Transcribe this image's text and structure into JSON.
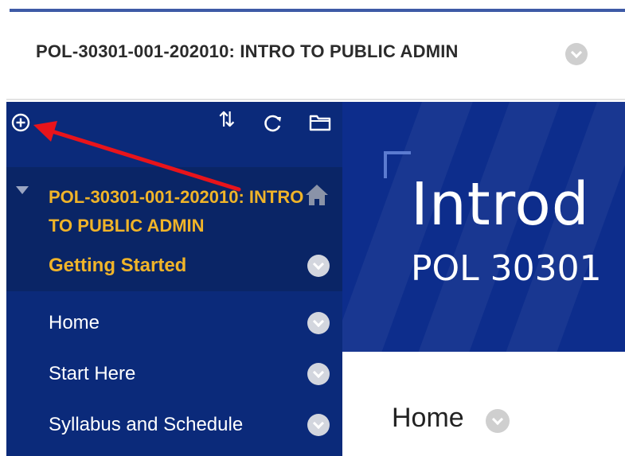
{
  "course_header": {
    "title": "POL-30301-001-202010: INTRO TO PUBLIC ADMIN",
    "menu_icon": "chevron-down-icon"
  },
  "sidebar": {
    "toolbar": {
      "add_icon": "plus-circle-icon",
      "sort_icon": "reorder-arrows-icon",
      "refresh_icon": "refresh-icon",
      "folder_icon": "folder-icon"
    },
    "course_name": "POL-30301-001-202010: INTRO TO PUBLIC ADMIN",
    "home_icon": "home-icon",
    "items": [
      {
        "label": "Getting Started",
        "active": true
      },
      {
        "label": "Home",
        "active": false
      },
      {
        "label": "Start Here",
        "active": false
      },
      {
        "label": "Syllabus and Schedule",
        "active": false
      }
    ]
  },
  "banner": {
    "title": "Introd",
    "subtitle": "POL 30301"
  },
  "content": {
    "heading": "Home"
  },
  "colors": {
    "sidebar_bg": "#0b2a7a",
    "sidebar_active_bg": "#0a2566",
    "accent_gold": "#f0b429",
    "banner_bg": "#0d2d8c",
    "annotation_arrow": "#e8141b"
  }
}
